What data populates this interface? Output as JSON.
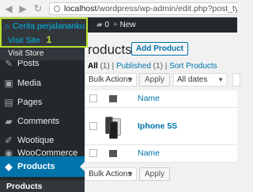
{
  "browser": {
    "url_host": "localhost",
    "url_path": "/wordpress/wp-admin/edit.php?post_type=product"
  },
  "adminbar": {
    "comments_count": "0",
    "new_label": "New",
    "site_dropdown": {
      "site_name": "Cerita perjalananku",
      "visit_site": "Visit Site",
      "annotation": "1",
      "visit_store": "Visit Store"
    }
  },
  "sidebar": {
    "items": [
      {
        "label": "Posts",
        "icon": "pin-icon"
      },
      {
        "label": "Media",
        "icon": "media-icon"
      },
      {
        "label": "Pages",
        "icon": "page-icon"
      },
      {
        "label": "Comments",
        "icon": "comments-icon"
      },
      {
        "label": "Wootique",
        "icon": "brush-icon"
      },
      {
        "label": "WooCommerce",
        "icon": "woo-icon"
      },
      {
        "label": "Products",
        "icon": "cube-icon"
      }
    ],
    "submenu_current": "Products"
  },
  "main": {
    "title": "roducts",
    "add_new": "Add Product",
    "filters": {
      "all_label": "All",
      "all_count": "(1)",
      "published_label": "Published",
      "published_count": "(1)",
      "sort_label": "Sort Products",
      "sep": "|"
    },
    "bulk_actions": "Bulk Actions",
    "apply": "Apply",
    "all_dates": "All dates",
    "column_name": "Name",
    "product_name": "Iphone 5S"
  }
}
